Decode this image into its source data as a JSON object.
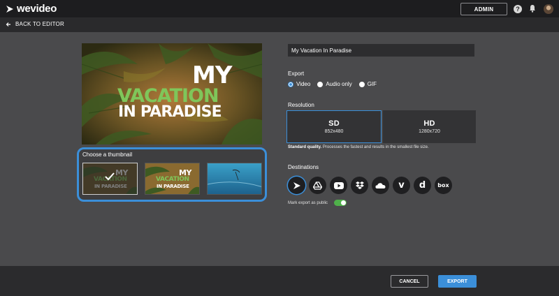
{
  "app": {
    "brand": "wevideo"
  },
  "topbar": {
    "admin_label": "ADMIN",
    "help_glyph": "?"
  },
  "backbar": {
    "label": "BACK TO EDITOR"
  },
  "preview": {
    "title_line1": "MY",
    "title_line2": "VACATION",
    "title_line3": "IN PARADISE"
  },
  "thumbnails": {
    "label": "Choose a thumbnail",
    "items": [
      {
        "id": "thumb-1",
        "selected": true
      },
      {
        "id": "thumb-2",
        "selected": false
      },
      {
        "id": "thumb-3",
        "selected": false
      }
    ]
  },
  "form": {
    "title_value": "My Vacation In Paradise",
    "export_label": "Export",
    "export_options": [
      "Video",
      "Audio only",
      "GIF"
    ],
    "export_selected": "Video",
    "resolution_label": "Resolution",
    "resolutions": [
      {
        "name": "SD",
        "size": "852x480",
        "selected": true
      },
      {
        "name": "HD",
        "size": "1280x720",
        "selected": false
      }
    ],
    "resolution_note_bold": "Standard quality.",
    "resolution_note": " Processes the fastest and results in the smallest file size.",
    "destinations_label": "Destinations",
    "destinations": [
      {
        "icon": "wevideo-icon",
        "selected": true
      },
      {
        "icon": "google-drive-icon",
        "selected": false
      },
      {
        "icon": "youtube-icon",
        "selected": false
      },
      {
        "icon": "dropbox-icon",
        "selected": false
      },
      {
        "icon": "onedrive-icon",
        "selected": false
      },
      {
        "icon": "vimeo-icon",
        "selected": false,
        "glyph": "v"
      },
      {
        "icon": "dailymotion-icon",
        "selected": false,
        "glyph": "d"
      },
      {
        "icon": "box-icon",
        "selected": false,
        "glyph": "box"
      }
    ],
    "public_label": "Mark export as public",
    "public_on": true
  },
  "footer": {
    "cancel_label": "CANCEL",
    "export_label": "EXPORT"
  },
  "colors": {
    "accent": "#3b8fd9",
    "toggle_on": "#4fb04a",
    "title_green": "#7fc65a"
  }
}
